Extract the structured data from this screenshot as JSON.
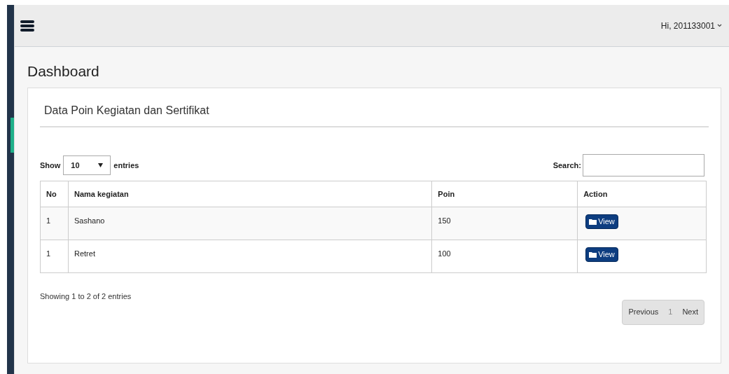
{
  "header": {
    "user_menu": "Hi, 201133001"
  },
  "page_title": "Dashboard",
  "card": {
    "title": "Data Poin Kegiatan dan Sertifikat",
    "length": {
      "before": "Show",
      "value": "10",
      "after": "entries"
    },
    "search": {
      "label": "Search:"
    },
    "table": {
      "columns": [
        "No",
        "Nama kegiatan",
        "Poin",
        "Action"
      ],
      "rows": [
        {
          "no": "1",
          "name": "Sashano",
          "poin": "150",
          "action": "View"
        },
        {
          "no": "1",
          "name": "Retret",
          "poin": "100",
          "action": "View"
        }
      ]
    },
    "info": "Showing 1 to 2 of 2 entries",
    "pagination": [
      {
        "label": "Previous",
        "kind": "nav"
      },
      {
        "label": "1",
        "kind": "page",
        "selected": true
      },
      {
        "label": "Next",
        "kind": "nav"
      }
    ]
  }
}
